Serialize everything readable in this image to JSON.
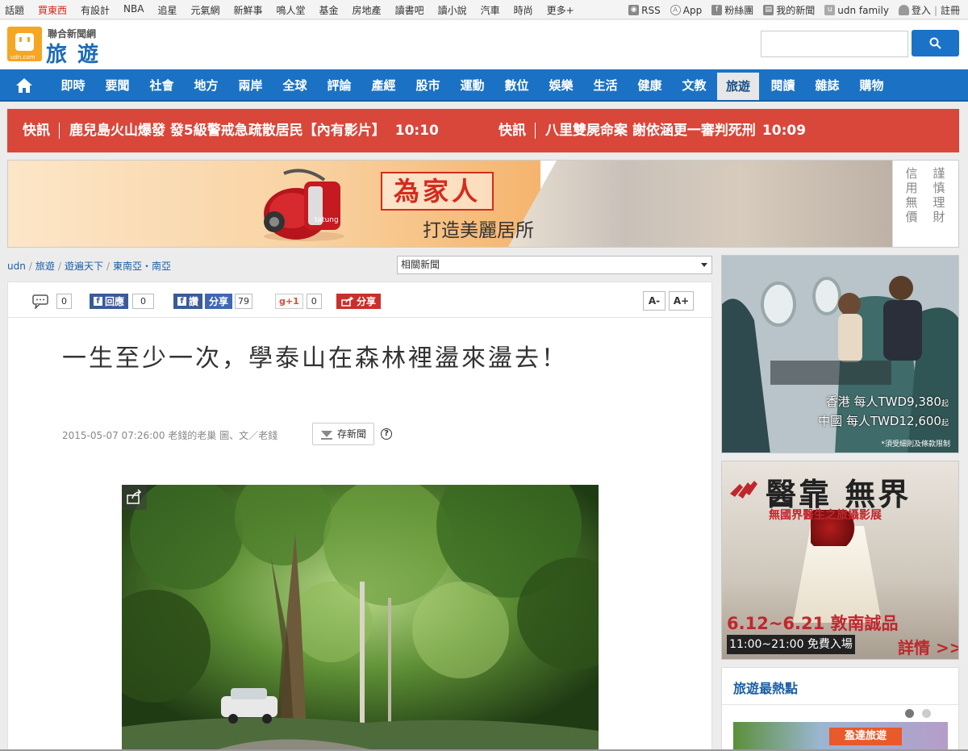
{
  "topbar": {
    "links": [
      "話題",
      "買東西",
      "有設計",
      "NBA",
      "追星",
      "元氣網",
      "新鮮事",
      "鳴人堂",
      "基金",
      "房地產",
      "讀書吧",
      "讀小說",
      "汽車",
      "時尚",
      "更多+"
    ],
    "right": {
      "rss": "RSS",
      "app": "App",
      "fans": "粉絲團",
      "mynews": "我的新聞",
      "family": "udn family",
      "login": "登入",
      "register": "註冊",
      "sep": "|"
    }
  },
  "logo": {
    "network": "聯合新聞網",
    "section": "旅 遊",
    "small": "udn.com"
  },
  "search": {
    "placeholder": "",
    "icon": "search-icon"
  },
  "nav": {
    "items": [
      "即時",
      "要聞",
      "社會",
      "地方",
      "兩岸",
      "全球",
      "評論",
      "產經",
      "股市",
      "運動",
      "數位",
      "娛樂",
      "生活",
      "健康",
      "文教",
      "旅遊",
      "閱讀",
      "雜誌",
      "購物"
    ],
    "active_index": 15
  },
  "flash": {
    "items": [
      {
        "label": "快訊",
        "text": "鹿兒島火山爆發 發5級警戒急疏散居民【內有影片】",
        "time": "10:10"
      },
      {
        "label": "快訊",
        "text": "八里雙屍命案 謝依涵更一審判死刑",
        "time": "10:09"
      }
    ]
  },
  "banner": {
    "slogan1": "為家人",
    "slogan2": "打造美麗居所",
    "vacuum_brand": "tatung",
    "side": [
      "信用無價",
      "謹慎理財"
    ]
  },
  "breadcrumb": {
    "items": [
      "udn",
      "旅遊",
      "遊遍天下",
      "東南亞・南亞"
    ],
    "sep": "/"
  },
  "related": {
    "selected": "相關新聞"
  },
  "sharebar": {
    "comment_count": "0",
    "fb_label": "回應",
    "fb_count": "0",
    "fb_like": "讚",
    "fb_share": "分享",
    "fb_share_count": "79",
    "gplus_label": "g+1",
    "gplus_count": "0",
    "share_label": "分享",
    "font_minus": "A-",
    "font_plus": "A+"
  },
  "article": {
    "title": "一生至少一次，學泰山在森林裡盪來盪去！",
    "meta": "2015-05-07 07:26:00 老錢的老巢 圖、文／老錢",
    "save_label": "存新聞",
    "help": "?"
  },
  "ad1": {
    "line1": "香港 每人TWD9,380",
    "line2": "中國 每人TWD12,600",
    "suffix": "起",
    "note": "*須受細則及條款限制"
  },
  "ad2": {
    "title": "醫靠 無界",
    "subtitle": "無國界醫生之旅攝影展",
    "date": "6.12~6.21 敦南誠品",
    "time": "11:00~21:00 免費入場",
    "more": "詳情 >>"
  },
  "hot": {
    "title": "旅遊最熱點",
    "badge": "盈達旅遊",
    "active_dot": 1,
    "dot_count": 2
  }
}
